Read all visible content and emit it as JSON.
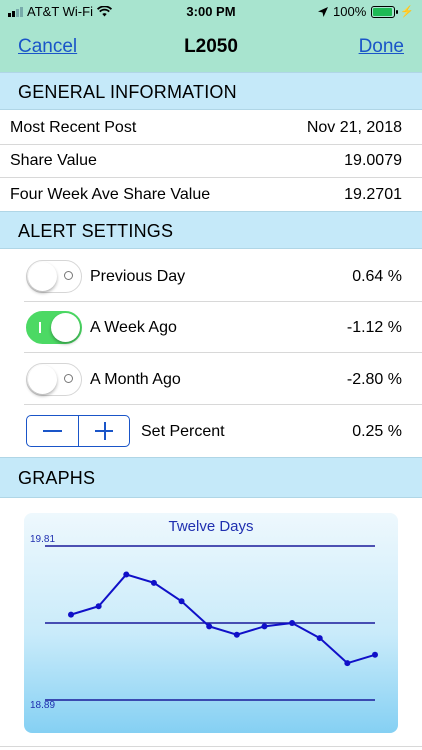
{
  "status_bar": {
    "carrier": "AT&T Wi-Fi",
    "time": "3:00 PM",
    "battery": "100%"
  },
  "nav": {
    "cancel": "Cancel",
    "title": "L2050",
    "done": "Done"
  },
  "general": {
    "header": "GENERAL INFORMATION",
    "rows": [
      {
        "label": "Most Recent Post",
        "value": "Nov 21, 2018"
      },
      {
        "label": "Share Value",
        "value": "19.0079"
      },
      {
        "label": "Four Week Ave Share Value",
        "value": "19.2701"
      }
    ]
  },
  "alerts": {
    "header": "ALERT SETTINGS",
    "rows": [
      {
        "label": "Previous Day",
        "value": "0.64 %",
        "on": false
      },
      {
        "label": "A Week Ago",
        "value": "-1.12 %",
        "on": true
      },
      {
        "label": "A Month Ago",
        "value": "-2.80 %",
        "on": false
      }
    ],
    "set_percent": {
      "label": "Set Percent",
      "value": "0.25 %"
    }
  },
  "graphs": {
    "header": "GRAPHS"
  },
  "chart_data": {
    "type": "line",
    "title": "Twelve Days",
    "tick_labels": [
      "19.81",
      "18.89"
    ],
    "ylim": [
      18.89,
      19.81
    ],
    "reference_lines": [
      19.81,
      19.35,
      18.89
    ],
    "x": [
      1,
      2,
      3,
      4,
      5,
      6,
      7,
      8,
      9,
      10,
      11,
      12
    ],
    "values": [
      19.4,
      19.45,
      19.64,
      19.59,
      19.48,
      19.33,
      19.28,
      19.33,
      19.35,
      19.26,
      19.11,
      19.16
    ],
    "line_color": "#1010c8",
    "grid_line_color": "#1a1a9a"
  }
}
